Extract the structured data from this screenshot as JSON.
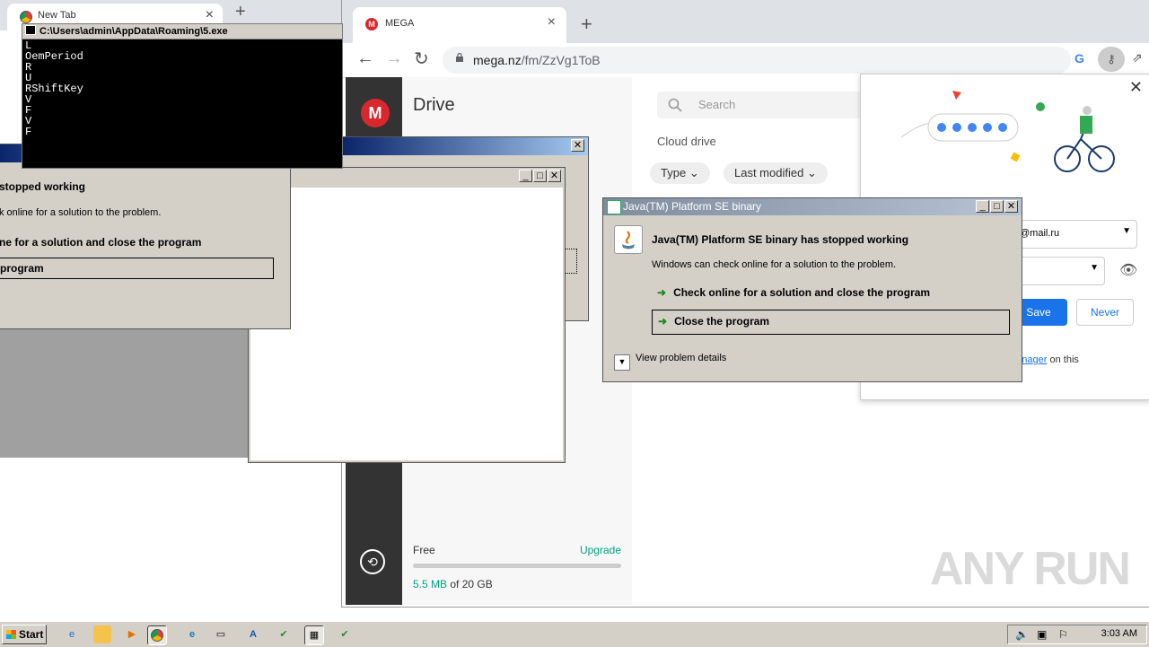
{
  "bg_browser": {
    "tab_title": "New Tab",
    "tab_close": "×",
    "new_tab": "+"
  },
  "mega_browser": {
    "tab_title": "MEGA",
    "tab_close": "×",
    "new_tab": "+",
    "url_domain": "mega.nz",
    "url_path": "/fm/ZzVg1ToB",
    "sidebar": {
      "logo": "M"
    },
    "left_panel": {
      "title": "Drive",
      "storage_label": "Free",
      "upgrade": "Upgrade",
      "used": "5.5 MB",
      "of_total": "of 20 GB",
      "usage_fraction": 0.0003
    },
    "main": {
      "search_placeholder": "Search",
      "section": "Cloud drive",
      "filters": [
        "Type",
        "Last modified"
      ]
    },
    "password_popup": {
      "username": "@mail.ru",
      "save": "Save",
      "never": "Never",
      "footer_link": "assword Manager",
      "footer_suffix": " on this"
    }
  },
  "console": {
    "title": "C:\\Users\\admin\\AppData\\Roaming\\5.exe",
    "lines": [
      "L",
      "OemPeriod",
      "R",
      "U",
      "RShiftKey",
      "V",
      "F",
      "V",
      "F"
    ]
  },
  "dialog_left": {
    "heading": "stopped working",
    "subtext": "k online for a solution to the problem.",
    "option1": "ne for a solution and close the program",
    "option2": "program"
  },
  "java_dialog": {
    "title": "Java(TM) Platform SE binary",
    "heading": "Java(TM) Platform SE binary has stopped working",
    "subtext": "Windows can check online for a solution to the problem.",
    "option1": "Check online for a solution and close the program",
    "option2": "Close the program",
    "details": "View problem details"
  },
  "taskbar": {
    "start": "Start",
    "clock": "3:03 AM"
  },
  "watermark": "ANY RUN",
  "colors": {
    "mega_red": "#d9272e",
    "mega_green": "#00a382",
    "chrome_blue": "#1a73e8"
  }
}
